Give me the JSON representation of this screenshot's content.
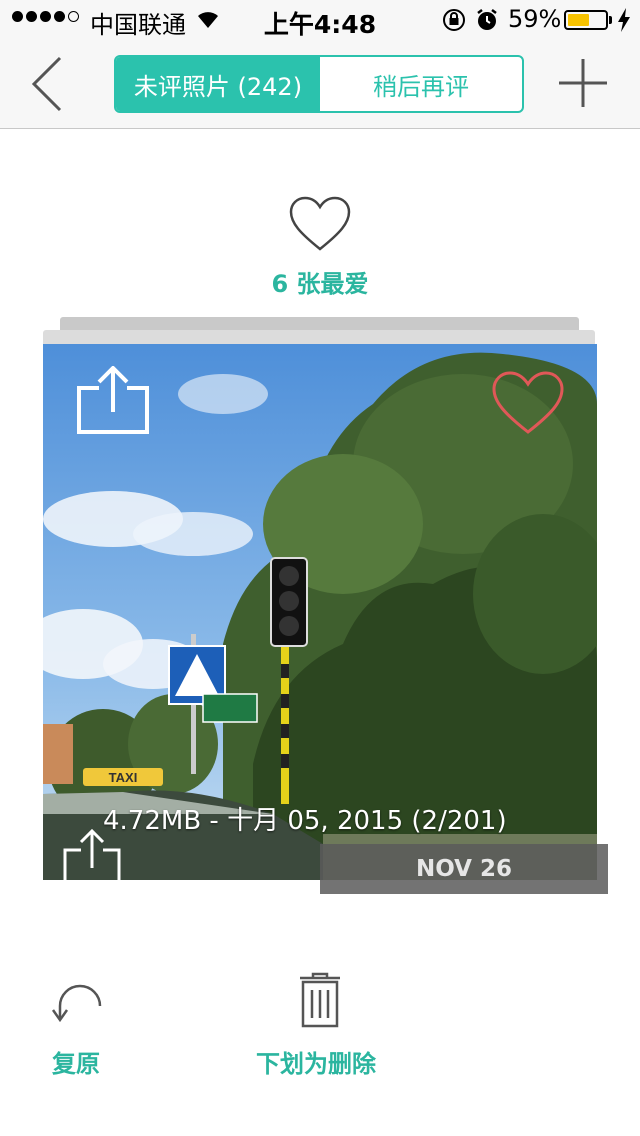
{
  "status_bar": {
    "carrier": "中国联通",
    "time": "上午4:48",
    "battery_percent": "59%",
    "battery_level": 0.59,
    "signal_bars_filled": 4,
    "signal_bars_total": 5,
    "battery_color": "#f8c300"
  },
  "nav": {
    "tab_unrated": "未评照片 (242)",
    "tab_later": "稍后再评",
    "accent_color": "#2bc2ad",
    "back_icon": "chevron-left-icon",
    "add_icon": "plus-icon"
  },
  "favorites": {
    "label": "6 张最爱",
    "icon": "heart-outline-icon"
  },
  "photo": {
    "meta": "4.72MB - 十月 05, 2015 (2/201)",
    "date_badge": "NOV 26",
    "sign_text_1": "TAXI",
    "share_icon": "share-icon",
    "favorite_icon": "heart-icon",
    "favorite_color": "#e05858"
  },
  "actions": {
    "undo_label": "复原",
    "delete_label": "下划为删除",
    "undo_icon": "undo-icon",
    "delete_icon": "trash-icon",
    "label_color": "#2bb59f"
  }
}
